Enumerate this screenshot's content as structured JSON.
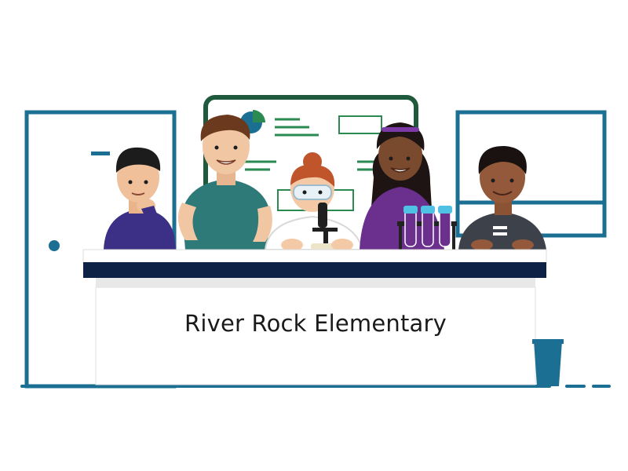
{
  "scene": {
    "desk_sign": "River Rock Elementary",
    "icons": [
      "classroom-door-icon",
      "whiteboard-icon",
      "pie-chart-icon",
      "window-icon",
      "microscope-icon",
      "test-tube-rack-icon",
      "trash-can-icon"
    ]
  },
  "colors": {
    "wall_outline": "#1b6f93",
    "board_frame": "#1f5a3c",
    "board_lines": "#2a8a52",
    "desk_top": "#0e2246",
    "desk_face": "#ffffff"
  }
}
